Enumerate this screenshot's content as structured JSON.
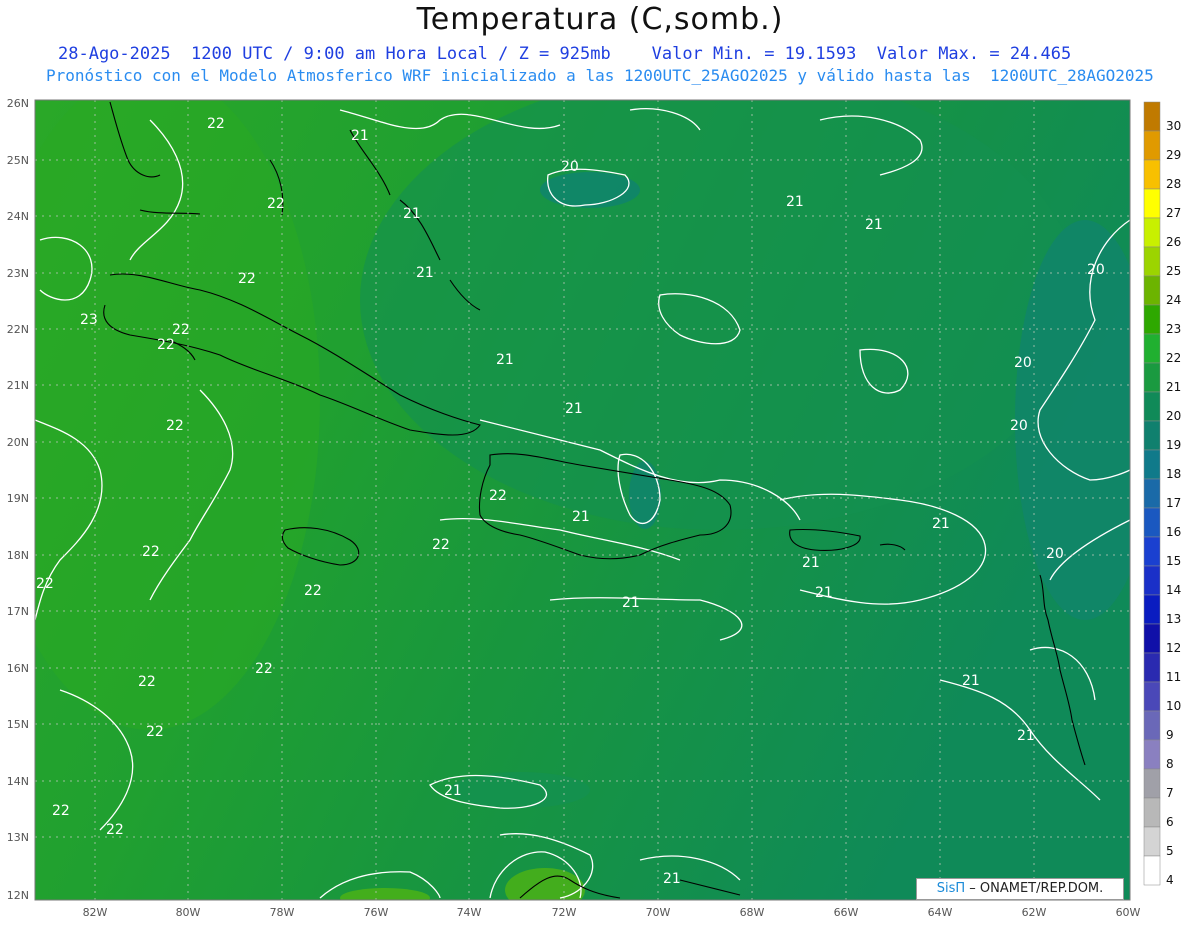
{
  "header": {
    "title": "Temperatura (C,somb.)",
    "line1": "28-Ago-2025  1200 UTC / 9:00 am Hora Local / Z = 925mb    Valor Min. = 19.1593  Valor Max. = 24.465",
    "line2": "Pronóstico con el Modelo Atmosferico WRF inicializado a las 1200UTC_25AGO2025 y válido hasta las  1200UTC_28AGO2025"
  },
  "axes": {
    "lat_labels": [
      "26N",
      "25N",
      "24N",
      "23N",
      "22N",
      "21N",
      "20N",
      "19N",
      "18N",
      "17N",
      "16N",
      "15N",
      "14N",
      "13N",
      "12N"
    ],
    "lon_labels": [
      "82W",
      "80W",
      "78W",
      "76W",
      "74W",
      "72W",
      "70W",
      "68W",
      "66W",
      "64W",
      "62W",
      "60W"
    ]
  },
  "colorbar": {
    "levels": [
      "30",
      "29",
      "28",
      "27",
      "26",
      "25",
      "24",
      "23",
      "22",
      "21",
      "20",
      "19",
      "18",
      "17",
      "16",
      "15",
      "14",
      "13",
      "12",
      "11",
      "10",
      "9",
      "8",
      "7",
      "6",
      "5",
      "4"
    ],
    "colors": [
      "#c07a00",
      "#e09a00",
      "#f8c000",
      "#ffff00",
      "#c8f000",
      "#9cd400",
      "#6cb400",
      "#2ea800",
      "#20b030",
      "#1a9a40",
      "#108a58",
      "#10806e",
      "#107a8a",
      "#1a6aa8",
      "#1a58c0",
      "#1a40d0",
      "#1a30c8",
      "#0a1cc0",
      "#1010a8",
      "#2a2ab0",
      "#4a48b8",
      "#6a68b8",
      "#8a80c0",
      "#a0a0a8",
      "#b8b8b8",
      "#d4d4d4",
      "#ffffff"
    ]
  },
  "contour_labels": [
    "22",
    "21",
    "21",
    "20",
    "22",
    "21",
    "21",
    "21",
    "20",
    "22",
    "22",
    "21",
    "22",
    "23",
    "20",
    "21",
    "20",
    "22",
    "21",
    "20",
    "22",
    "22",
    "21",
    "22",
    "22",
    "21",
    "21",
    "21",
    "22",
    "22",
    "22",
    "22",
    "21",
    "21",
    "22",
    "21",
    "22",
    "21"
  ],
  "credit": {
    "brand": "SisΠ",
    "text": "– ONAMET/REP.DOM."
  }
}
